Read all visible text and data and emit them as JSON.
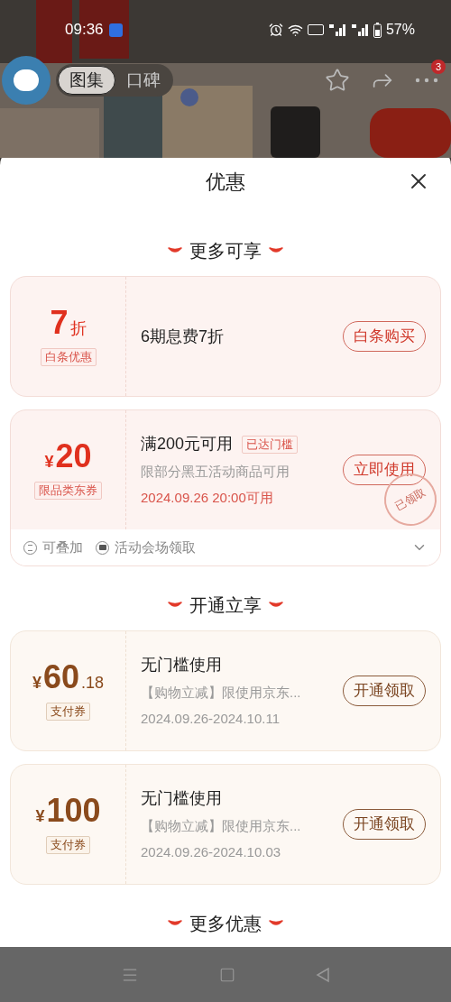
{
  "status_bar": {
    "time": "09:36",
    "battery": "57%"
  },
  "header": {
    "tabs": [
      {
        "label": "图集",
        "selected": true
      },
      {
        "label": "口碑",
        "selected": false
      }
    ],
    "more_badge": "3"
  },
  "sheet": {
    "title": "优惠",
    "sections": [
      {
        "title": "更多可享",
        "coupons": [
          {
            "kind": "red",
            "value": "7",
            "suffix": "折",
            "tag": "白条优惠",
            "title": "6期息费7折",
            "button": "白条购买"
          },
          {
            "kind": "red",
            "prefix": "¥",
            "value": "20",
            "tag": "限品类东券",
            "title": "满200元可用",
            "badge": "已达门槛",
            "lines": [
              {
                "text": "限部分黑五活动商品可用",
                "kind": "muted"
              },
              {
                "text": "2024.09.26 20:00可用",
                "kind": "accent"
              }
            ],
            "button": "立即使用",
            "stamp": "已领取",
            "footer": [
              {
                "kind": "stack",
                "text": "可叠加"
              },
              {
                "kind": "venue",
                "text": "活动会场领取"
              }
            ]
          }
        ]
      },
      {
        "title": "开通立享",
        "coupons": [
          {
            "kind": "brown",
            "prefix": "¥",
            "value": "60",
            "suffix": ".18",
            "tag": "支付券",
            "title": "无门槛使用",
            "lines": [
              {
                "text": "【购物立减】限使用京东...",
                "kind": "muted"
              },
              {
                "text": "2024.09.26-2024.10.11",
                "kind": "muted"
              }
            ],
            "button": "开通领取"
          },
          {
            "kind": "brown",
            "prefix": "¥",
            "value": "100",
            "tag": "支付券",
            "title": "无门槛使用",
            "lines": [
              {
                "text": "【购物立减】限使用京东...",
                "kind": "muted"
              },
              {
                "text": "2024.09.26-2024.10.03",
                "kind": "muted"
              }
            ],
            "button": "开通领取"
          }
        ]
      },
      {
        "title": "更多优惠"
      }
    ]
  }
}
